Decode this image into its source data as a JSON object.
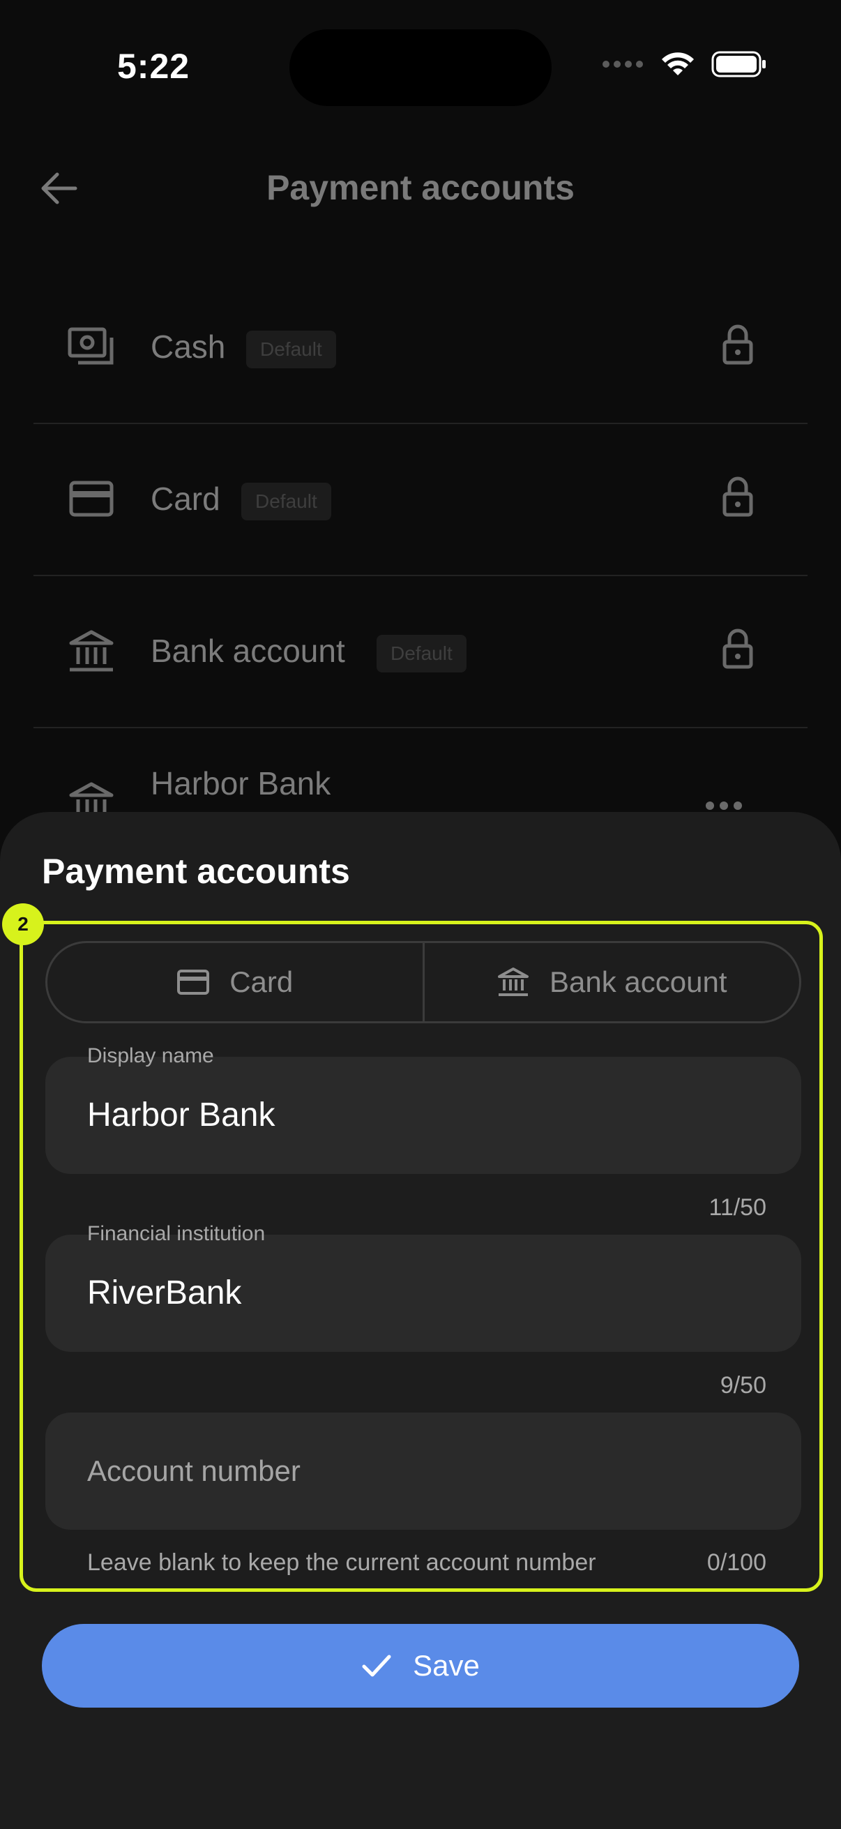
{
  "status_bar": {
    "time": "5:22"
  },
  "background": {
    "title": "Payment accounts",
    "accounts": [
      {
        "label": "Cash",
        "badge": "Default",
        "icon": "cash-icon",
        "locked": true
      },
      {
        "label": "Card",
        "badge": "Default",
        "icon": "card-icon",
        "locked": true
      },
      {
        "label": "Bank account",
        "badge": "Default",
        "icon": "bank-icon",
        "locked": true
      },
      {
        "label": "Harbor Bank",
        "icon": "bank-icon"
      }
    ]
  },
  "sheet": {
    "title": "Payment accounts",
    "step": "2",
    "type_options": [
      {
        "label": "Card",
        "icon": "card-icon"
      },
      {
        "label": "Bank account",
        "icon": "bank-icon"
      }
    ],
    "display_name": {
      "label": "Display name",
      "value": "Harbor Bank",
      "counter": "11/50"
    },
    "institution": {
      "label": "Financial institution",
      "value": "RiverBank",
      "counter": "9/50"
    },
    "account_number": {
      "placeholder": "Account number",
      "helper": "Leave blank to keep the current account number",
      "counter": "0/100"
    },
    "save_label": "Save"
  },
  "colors": {
    "accent": "#5a8be8",
    "highlight": "#d7f21c",
    "sheet_bg": "#1d1d1d",
    "field_bg": "#2a2a2a"
  }
}
